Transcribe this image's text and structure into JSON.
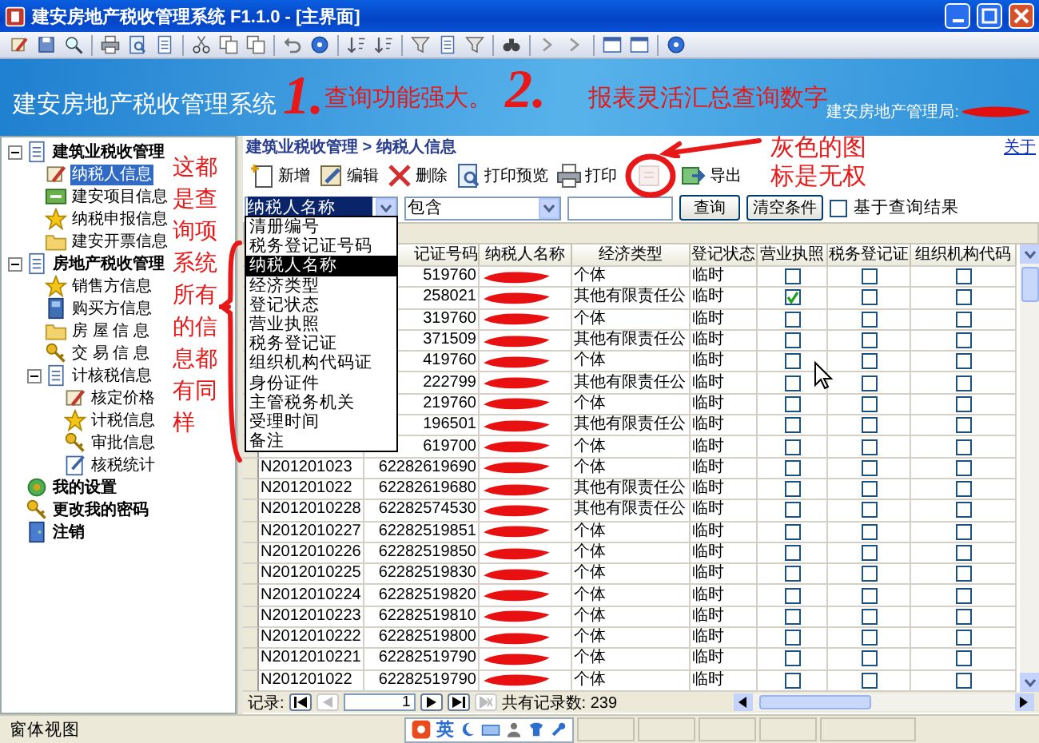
{
  "window": {
    "title": "建安房地产税收管理系统 F1.1.0 - [主界面]"
  },
  "banner": {
    "title": "建安房地产税收管理系统",
    "user_label": "建安房地产管理局:",
    "user_redacted": true
  },
  "nav_tree": [
    {
      "label": "建筑业税收管理",
      "kind": "doc",
      "expanded": true,
      "selected": false,
      "children": [
        {
          "label": "纳税人信息",
          "kind": "pen",
          "selected": true
        },
        {
          "label": "建安项目信息",
          "kind": "card",
          "selected": false
        },
        {
          "label": "纳税申报信息",
          "kind": "star",
          "selected": false
        },
        {
          "label": "建安开票信息",
          "kind": "folder",
          "selected": false
        }
      ]
    },
    {
      "label": "房地产税收管理",
      "kind": "doc",
      "expanded": true,
      "selected": false,
      "children": [
        {
          "label": "销售方信息",
          "kind": "star",
          "selected": false
        },
        {
          "label": "购买方信息",
          "kind": "book",
          "selected": false
        },
        {
          "label": "房 屋 信 息",
          "kind": "folder",
          "selected": false
        },
        {
          "label": "交 易 信 息",
          "kind": "key",
          "selected": false
        },
        {
          "label": "计核税信息",
          "kind": "doc",
          "expanded": true,
          "selected": false,
          "children": [
            {
              "label": "核定价格",
              "kind": "pen",
              "selected": false
            },
            {
              "label": "计税信息",
              "kind": "star",
              "selected": false
            },
            {
              "label": "审批信息",
              "kind": "key",
              "selected": false
            },
            {
              "label": "核税统计",
              "kind": "note",
              "selected": false
            }
          ]
        }
      ]
    },
    {
      "label": "我的设置",
      "kind": "gear",
      "selected": false
    },
    {
      "label": "更改我的密码",
      "kind": "key",
      "selected": false
    },
    {
      "label": "注销",
      "kind": "door",
      "selected": false
    }
  ],
  "breadcrumb": "建筑业税收管理 > 纳税人信息",
  "about_link": "关于",
  "actions": [
    {
      "kind": "new",
      "label": "新增",
      "disabled": false
    },
    {
      "kind": "edit",
      "label": "编辑",
      "disabled": false
    },
    {
      "kind": "delete",
      "label": "删除",
      "disabled": false
    },
    {
      "kind": "preview",
      "label": "打印预览",
      "disabled": false
    },
    {
      "kind": "print",
      "label": "打印",
      "disabled": false
    },
    {
      "kind": "faded",
      "disabled": true
    },
    {
      "kind": "export",
      "label": "导出",
      "disabled": false
    }
  ],
  "filter": {
    "field": "纳税人名称",
    "operator": "包含",
    "search_button": "查询",
    "clear_button": "清空条件",
    "within_results": {
      "label": "基于查询结果",
      "checked": false
    }
  },
  "field_menu": [
    {
      "label": "清册编号",
      "selected": false
    },
    {
      "label": "税务登记证号码",
      "selected": false
    },
    {
      "label": "纳税人名称",
      "selected": true
    },
    {
      "label": "经济类型",
      "selected": false
    },
    {
      "label": "登记状态",
      "selected": false
    },
    {
      "label": "营业执照",
      "selected": false
    },
    {
      "label": "税务登记证",
      "selected": false
    },
    {
      "label": "组织机构代码证",
      "selected": false
    },
    {
      "label": "身份证件",
      "selected": false
    },
    {
      "label": "主管税务机关",
      "selected": false
    },
    {
      "label": "受理时间",
      "selected": false
    },
    {
      "label": "备注",
      "selected": false
    }
  ],
  "table": {
    "columns": [
      "记证号码",
      "纳税人名称",
      "经济类型",
      "登记状态",
      "营业执照",
      "税务登记证",
      "组织机构代码"
    ],
    "rows": [
      {
        "code": "519760",
        "redacted": true,
        "type": "个体",
        "status": "临时",
        "license": false,
        "tax_cert": false,
        "org_code": false
      },
      {
        "code": "258021",
        "redacted": true,
        "type": "其他有限责任公",
        "status": "临时",
        "license": true,
        "tax_cert": false,
        "org_code": false
      },
      {
        "code": "319760",
        "redacted": true,
        "type": "个体",
        "status": "临时",
        "license": false,
        "tax_cert": false,
        "org_code": false
      },
      {
        "code": "371509",
        "redacted": true,
        "type": "其他有限责任公",
        "status": "临时",
        "license": false,
        "tax_cert": false,
        "org_code": false
      },
      {
        "code": "419760",
        "redacted": true,
        "type": "个体",
        "status": "临时",
        "license": false,
        "tax_cert": false,
        "org_code": false
      },
      {
        "code": "222799",
        "redacted": true,
        "type": "其他有限责任公",
        "status": "临时",
        "license": false,
        "tax_cert": false,
        "org_code": false
      },
      {
        "code": "219760",
        "redacted": true,
        "type": "个体",
        "status": "临时",
        "license": false,
        "tax_cert": false,
        "org_code": false
      },
      {
        "code": "196501",
        "redacted": true,
        "type": "其他有限责任公",
        "status": "临时",
        "license": false,
        "tax_cert": false,
        "org_code": false
      },
      {
        "code": "619700",
        "redacted": true,
        "type": "个体",
        "status": "临时",
        "license": false,
        "tax_cert": false,
        "org_code": false
      },
      {
        "id": "N201201023",
        "code": "62282619690",
        "redacted": true,
        "type": "个体",
        "status": "临时",
        "license": false,
        "tax_cert": false,
        "org_code": false
      },
      {
        "id": "N201201022",
        "code": "62282619680",
        "redacted": true,
        "type": "其他有限责任公",
        "status": "临时",
        "license": false,
        "tax_cert": false,
        "org_code": false
      },
      {
        "id": "N2012010228",
        "code": "62282574530",
        "redacted": true,
        "type": "其他有限责任公",
        "status": "临时",
        "license": false,
        "tax_cert": false,
        "org_code": false
      },
      {
        "id": "N2012010227",
        "code": "62282519851",
        "redacted": true,
        "type": "个体",
        "status": "临时",
        "license": false,
        "tax_cert": false,
        "org_code": false
      },
      {
        "id": "N2012010226",
        "code": "62282519850",
        "redacted": true,
        "type": "个体",
        "status": "临时",
        "license": false,
        "tax_cert": false,
        "org_code": false
      },
      {
        "id": "N2012010225",
        "code": "62282519830",
        "redacted": true,
        "type": "个体",
        "status": "临时",
        "license": false,
        "tax_cert": false,
        "org_code": false
      },
      {
        "id": "N2012010224",
        "code": "62282519820",
        "redacted": true,
        "type": "个体",
        "status": "临时",
        "license": false,
        "tax_cert": false,
        "org_code": false
      },
      {
        "id": "N2012010223",
        "code": "62282519810",
        "redacted": true,
        "type": "个体",
        "status": "临时",
        "license": false,
        "tax_cert": false,
        "org_code": false
      },
      {
        "id": "N2012010222",
        "code": "62282519800",
        "redacted": true,
        "type": "个体",
        "status": "临时",
        "license": false,
        "tax_cert": false,
        "org_code": false
      },
      {
        "id": "N2012010221",
        "code": "62282519790",
        "redacted": true,
        "type": "个体",
        "status": "临时",
        "license": false,
        "tax_cert": false,
        "org_code": false
      },
      {
        "id": "N201201022",
        "code": "62282519790",
        "redacted": true,
        "type": "个体",
        "status": "临时",
        "license": false,
        "tax_cert": false,
        "org_code": false
      }
    ]
  },
  "footer": {
    "label": "记录:",
    "page": "1",
    "total": "共有记录数: 239"
  },
  "status_bar": {
    "view": "窗体视图",
    "ime": "英"
  },
  "annotations": {
    "banner_1": "1.",
    "banner_1_text": "查询功能强大。",
    "banner_2": "2.",
    "banner_2_text": "报表灵活汇总查询数字",
    "icon_note": "灰色的图标是无权",
    "menu_note": "这都是查询项系统所有的信息都有同样"
  }
}
